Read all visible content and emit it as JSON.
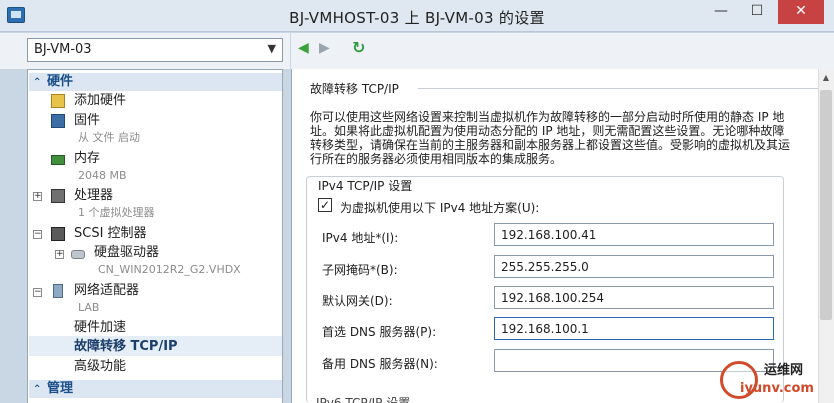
{
  "window": {
    "title": "BJ-VMHOST-03 上 BJ-VM-03 的设置",
    "min": "—",
    "max": "☐",
    "close": "✕"
  },
  "vm_selector": {
    "value": "BJ-VM-03"
  },
  "tree": {
    "hardware_header": "硬件",
    "management_header": "管理",
    "items": {
      "add_hardware": "添加硬件",
      "firmware": "固件",
      "firmware_sub": "从 文件 启动",
      "memory": "内存",
      "memory_sub": "2048 MB",
      "processor": "处理器",
      "processor_sub": "1 个虚拟处理器",
      "scsi": "SCSI 控制器",
      "hdd": "硬盘驱动器",
      "hdd_sub": "CN_WIN2012R2_G2.VHDX",
      "nic": "网络适配器",
      "nic_sub": "LAB",
      "hw_accel": "硬件加速",
      "failover": "故障转移 TCP/IP",
      "advanced": "高级功能"
    }
  },
  "content": {
    "section_title": "故障转移 TCP/IP",
    "description": "你可以使用这些网络设置来控制当虚拟机作为故障转移的一部分启动时所使用的静态 IP 地址。如果将此虚拟机配置为使用动态分配的 IP 地址，则无需配置这些设置。无论哪种故障转移类型，请确保在当前的主服务器和副本服务器上都设置这些值。受影响的虚拟机及其运行所在的服务器必须使用相同版本的集成服务。",
    "ipv4_group_title": "IPv4 TCP/IP 设置",
    "use_ipv4_checkbox_label": "为虚拟机使用以下 IPv4 地址方案(U):",
    "use_ipv4_checked": "✓",
    "fields": {
      "ipv4_label": "IPv4 地址*(I):",
      "ipv4_value": "192.168.100.41",
      "mask_label": "子网掩码*(B):",
      "mask_value": "255.255.255.0",
      "gateway_label": "默认网关(D):",
      "gateway_value": "192.168.100.254",
      "dns1_label": "首选 DNS 服务器(P):",
      "dns1_value": "192.168.100.1",
      "dns2_label": "备用 DNS 服务器(N):",
      "dns2_value": ""
    },
    "ipv6_group_title": "IPv6 TCP/IP 设置"
  },
  "watermark": {
    "top": "运维网",
    "bottom": "iyunv.com"
  }
}
